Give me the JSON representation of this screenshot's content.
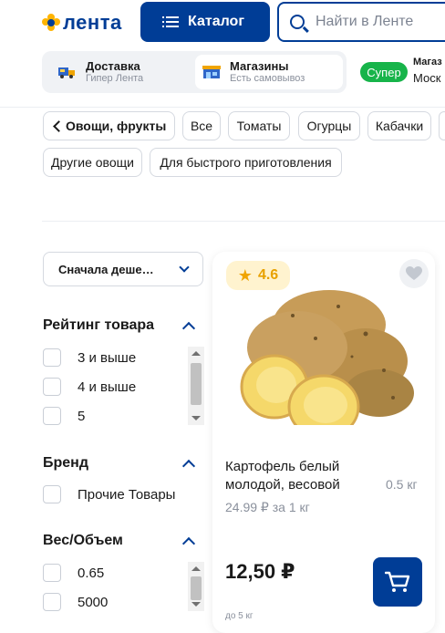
{
  "header": {
    "logo_text": "лента",
    "catalog_label": "Каталог",
    "search_placeholder": "Найти в Ленте"
  },
  "delivery": {
    "tabs": [
      {
        "title": "Доставка",
        "subtitle": "Гипер Лента"
      },
      {
        "title": "Магазины",
        "subtitle": "Есть самовывоз"
      }
    ],
    "store_badge": "Супер",
    "store_title": "Магаз",
    "store_address": "Моск"
  },
  "categories": {
    "back_label": "Овощи, фрукты",
    "chips": [
      "Все",
      "Томаты",
      "Огурцы",
      "Кабачки",
      "Другие овощи",
      "Для быстрого приготовления"
    ]
  },
  "sort": {
    "selected": "Сначала деше…"
  },
  "filters": {
    "rating": {
      "title": "Рейтинг товара",
      "options": [
        "3 и выше",
        "4 и выше",
        "5"
      ]
    },
    "brand": {
      "title": "Бренд",
      "options": [
        "Прочие Товары"
      ]
    },
    "volume": {
      "title": "Вес/Объем",
      "options": [
        "0.65",
        "5000"
      ]
    }
  },
  "product": {
    "rating": "4.6",
    "name": "Картофель белый молодой, весовой",
    "weight": "0.5 кг",
    "unit_price": "24.99 ₽ за 1 кг",
    "price": "12,50 ₽",
    "limit": "до 5 кг"
  },
  "colors": {
    "brand_blue": "#003d96",
    "badge_green": "#17b44a",
    "rating_bg": "#fff3cf",
    "star": "#f0a500"
  },
  "icons": [
    "lenta-logo-icon",
    "catalog-menu-icon",
    "search-icon",
    "truck-icon",
    "store-icon",
    "chevron-left-icon",
    "chevron-down-icon",
    "chevron-up-icon",
    "star-icon",
    "heart-icon",
    "cart-icon"
  ]
}
